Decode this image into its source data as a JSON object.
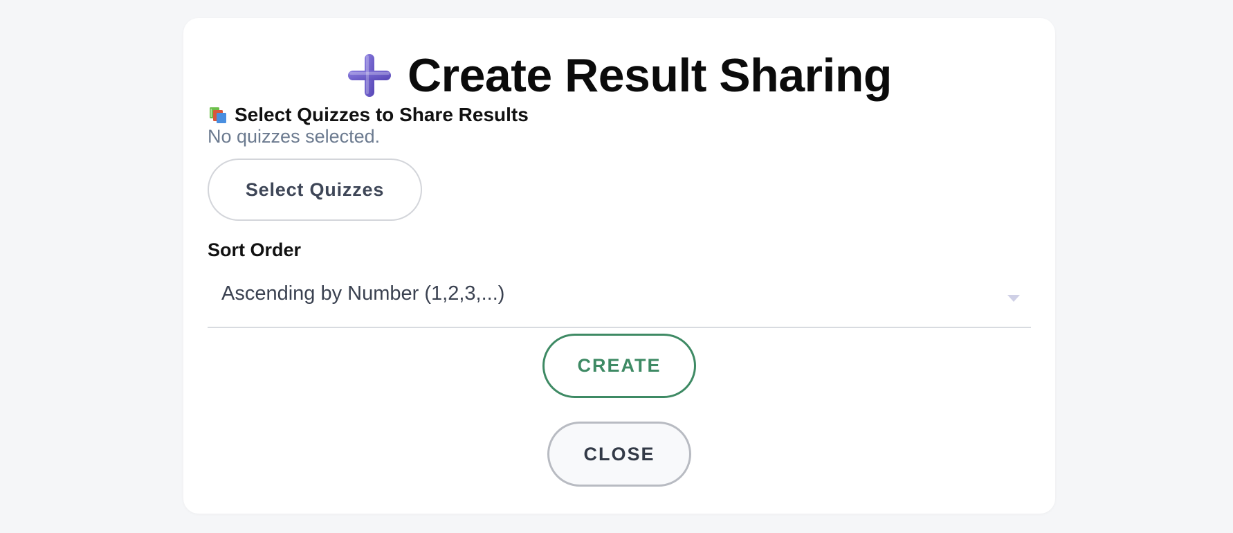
{
  "dialog": {
    "title": "Create Result Sharing",
    "title_icon": "plus-icon",
    "accent_color": "#6a5acd"
  },
  "quizzes_section": {
    "icon": "books-icon",
    "heading": "Select Quizzes to Share Results",
    "empty_text": "No quizzes selected.",
    "select_button_label": "Select Quizzes"
  },
  "sort": {
    "label": "Sort Order",
    "selected": "Ascending by Number (1,2,3,...)"
  },
  "actions": {
    "create_label": "CREATE",
    "create_color": "#3e8a64",
    "close_label": "CLOSE"
  }
}
